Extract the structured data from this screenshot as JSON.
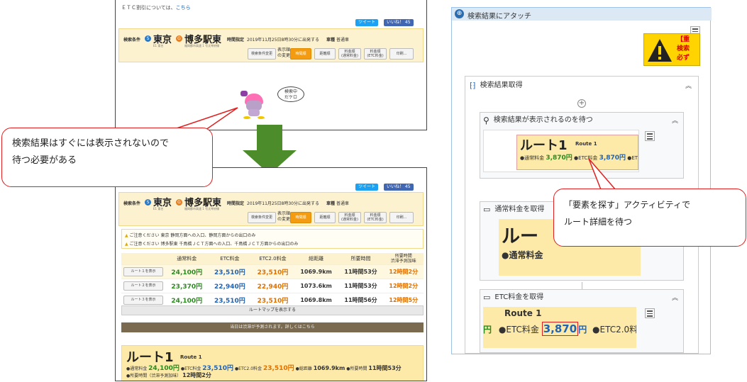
{
  "top_page": {
    "etc_note": "ＥＴＣ割引については、",
    "etc_link": "こちら",
    "tweet": "ツイート",
    "like": "いいね！ 45"
  },
  "search": {
    "label": "検索条件",
    "from": "東京",
    "from_sub": "E1 東名",
    "to": "博多駅東",
    "to_sub": "福岡都市高速 1 号太宰府線",
    "time_label": "時間指定",
    "time_value": "2019年11月25日8時30分に出発する",
    "vehicle_label": "車種",
    "vehicle_value": "普通車",
    "display_change": "表示順\nの変更",
    "buttons": [
      "検索条件変更",
      "時間順",
      "距離順",
      "料金順\n(通常料金)",
      "料金順\n(ETC料金)",
      "印刷..."
    ]
  },
  "loading": {
    "bubble": "検索中\nだケロ"
  },
  "notices": [
    {
      "text": "ご注意ください 東京 静岡方面への入口、静岡方面からの出口のみ"
    },
    {
      "text": "ご注意ください 博多駅東 千鳥橋ＪＣＴ方面への入口、千鳥橋ＪＣＴ方面からの出口のみ"
    }
  ],
  "table": {
    "headers": [
      "",
      "通常料金",
      "ETC料金",
      "ETC2.0料金",
      "総距離",
      "所要時間",
      "所要時間\n渋滞予測加味"
    ],
    "rows": [
      {
        "btn": "ルート１を表示",
        "normal": "24,100円",
        "etc": "23,510円",
        "etc2": "23,510円",
        "dist": "1069.9km",
        "time": "11時間53分",
        "time2": "12時間2分"
      },
      {
        "btn": "ルート２を表示",
        "normal": "23,370円",
        "etc": "22,940円",
        "etc2": "22,940円",
        "dist": "1073.6km",
        "time": "11時間53分",
        "time2": "12時間2分"
      },
      {
        "btn": "ルート３を表示",
        "normal": "24,100円",
        "etc": "23,510円",
        "etc2": "23,510円",
        "dist": "1069.8km",
        "time": "11時間56分",
        "time2": "12時間5分"
      }
    ],
    "map_button": "ルートマップを表示する",
    "jam_bar": "当日は渋滞が予測されます。詳しくはこちら"
  },
  "route_detail": {
    "title": "ルート1",
    "subtitle": "Route 1",
    "normal_label": "●通常料金",
    "normal": "24,100円",
    "etc_label": "●ETC料金",
    "etc": "23,510円",
    "etc2_label": "●ETC2.0料金",
    "etc2": "23,510円",
    "dist_label": "●総距離",
    "dist": "1069.9km",
    "time_label": "●所要時間",
    "time": "11時間53分",
    "time2_label": "●所要時間（渋滞予測加味）",
    "time2": "12時間2分"
  },
  "callouts": {
    "left": "検索結果はすぐには表示されないので\n待つ必要がある",
    "right": "「要素を探す」アクティビティで\nルート詳細を待つ"
  },
  "workflow": {
    "attach_title": "検索結果にアタッチ",
    "warn_text": "【重\n検索\n必ず",
    "get_results": "検索結果取得",
    "wait_title": "検索結果が表示されるのを待つ",
    "wait_route": "ルート1",
    "wait_route_sub": "Route 1",
    "wait_normal": "●通常料金",
    "wait_normal_val": "3,870円",
    "wait_etc": "●ETC料金",
    "wait_etc_val": "3,870円",
    "wait_etc2": "●ETC",
    "normal_title": "通常料金を取得",
    "normal_big": "ルー",
    "normal_row": "●通常料金",
    "etc_title": "ETC料金を取得",
    "etc_route": "Route 1",
    "etc_yen": "円",
    "etc_label": "●ETC料金",
    "etc_value": "3,870",
    "etc_unit": "円",
    "etc2": "●ETC2.0料"
  }
}
